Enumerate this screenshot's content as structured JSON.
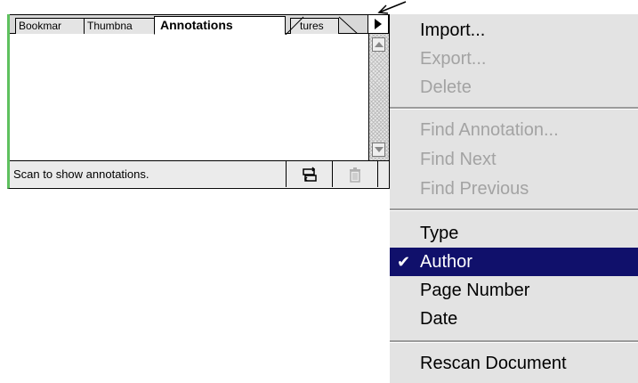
{
  "palette": {
    "tabs": [
      "Bookmar",
      "Thumbna",
      "Annotations",
      "tures"
    ],
    "active_tab_index": 2,
    "status_text": "Scan to show annotations.",
    "accent_color": "#5fc15f"
  },
  "icons": {
    "menu_button": "triangle-right-icon",
    "scroll_up": "triangle-up-icon",
    "scroll_down": "triangle-down-icon",
    "rescan": "refresh-icon",
    "delete": "trash-icon",
    "check": "checkmark-icon"
  },
  "menu": {
    "items": [
      {
        "label": "Import...",
        "enabled": true
      },
      {
        "label": "Export...",
        "enabled": false
      },
      {
        "label": "Delete",
        "enabled": false
      },
      {
        "label": "Find Annotation...",
        "enabled": false
      },
      {
        "label": "Find Next",
        "enabled": false
      },
      {
        "label": "Find Previous",
        "enabled": false
      },
      {
        "label": "Type",
        "enabled": true
      },
      {
        "label": "Author",
        "enabled": true,
        "checked": true,
        "highlighted": true
      },
      {
        "label": "Page Number",
        "enabled": true
      },
      {
        "label": "Date",
        "enabled": true
      },
      {
        "label": "Rescan Document",
        "enabled": true
      }
    ],
    "check_glyph": "✔",
    "highlight_color": "#10106b"
  }
}
